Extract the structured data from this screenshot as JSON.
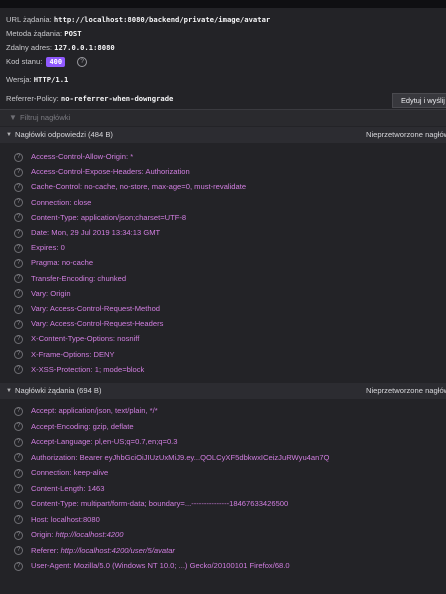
{
  "summary": {
    "url_label": "URL żądania:",
    "url_value": "http://localhost:8080/backend/private/image/avatar",
    "method_label": "Metoda żądania:",
    "method_value": "POST",
    "address_label": "Zdalny adres:",
    "address_value": "127.0.0.1:8080",
    "status_label": "Kod stanu:",
    "status_value": "400",
    "status_color": "#9059ff",
    "version_label": "Wersja:",
    "version_value": "HTTP/1.1",
    "referrer_label": "Referrer-Policy:",
    "referrer_value": "no-referrer-when-downgrade",
    "edit_button": "Edytuj i wyślij"
  },
  "filter": {
    "placeholder": "Filtruj nagłówki"
  },
  "response_headers": {
    "title": "Nagłówki odpowiedzi (484 B)",
    "raw_toggle": "Nieprzetworzone nagłówki",
    "items": [
      {
        "name": "Access-Control-Allow-Origin:",
        "value": "*"
      },
      {
        "name": "Access-Control-Expose-Headers:",
        "value": "Authorization"
      },
      {
        "name": "Cache-Control:",
        "value": "no-cache, no-store, max-age=0, must-revalidate"
      },
      {
        "name": "Connection:",
        "value": "close"
      },
      {
        "name": "Content-Type:",
        "value": "application/json;charset=UTF-8"
      },
      {
        "name": "Date:",
        "value": "Mon, 29 Jul 2019 13:34:13 GMT"
      },
      {
        "name": "Expires:",
        "value": "0"
      },
      {
        "name": "Pragma:",
        "value": "no-cache"
      },
      {
        "name": "Transfer-Encoding:",
        "value": "chunked"
      },
      {
        "name": "Vary:",
        "value": "Origin"
      },
      {
        "name": "Vary:",
        "value": "Access-Control-Request-Method"
      },
      {
        "name": "Vary:",
        "value": "Access-Control-Request-Headers"
      },
      {
        "name": "X-Content-Type-Options:",
        "value": "nosniff"
      },
      {
        "name": "X-Frame-Options:",
        "value": "DENY"
      },
      {
        "name": "X-XSS-Protection:",
        "value": "1; mode=block"
      }
    ]
  },
  "request_headers": {
    "title": "Nagłówki żądania (694 B)",
    "raw_toggle": "Nieprzetworzone nagłówki",
    "items": [
      {
        "name": "Accept:",
        "value": "application/json, text/plain, */*"
      },
      {
        "name": "Accept-Encoding:",
        "value": "gzip, deflate"
      },
      {
        "name": "Accept-Language:",
        "value": "pl,en-US;q=0.7,en;q=0.3"
      },
      {
        "name": "Authorization:",
        "value": "Bearer eyJhbGciOiJIUzUxMiJ9.ey...QOLCyXF5dbkwxICeizJuRWyu4an7Q"
      },
      {
        "name": "Connection:",
        "value": "keep-alive"
      },
      {
        "name": "Content-Length:",
        "value": "1463"
      },
      {
        "name": "Content-Type:",
        "value": "multipart/form-data; boundary=...---------------18467633426500"
      },
      {
        "name": "Host:",
        "value": "localhost:8080"
      },
      {
        "name": "Origin:",
        "value": "http://localhost:4200"
      },
      {
        "name": "Referer:",
        "value": "http://localhost:4200/user/5/avatar"
      },
      {
        "name": "User-Agent:",
        "value": "Mozilla/5.0 (Windows NT 10.0; ...) Gecko/20100101 Firefox/68.0"
      }
    ]
  }
}
